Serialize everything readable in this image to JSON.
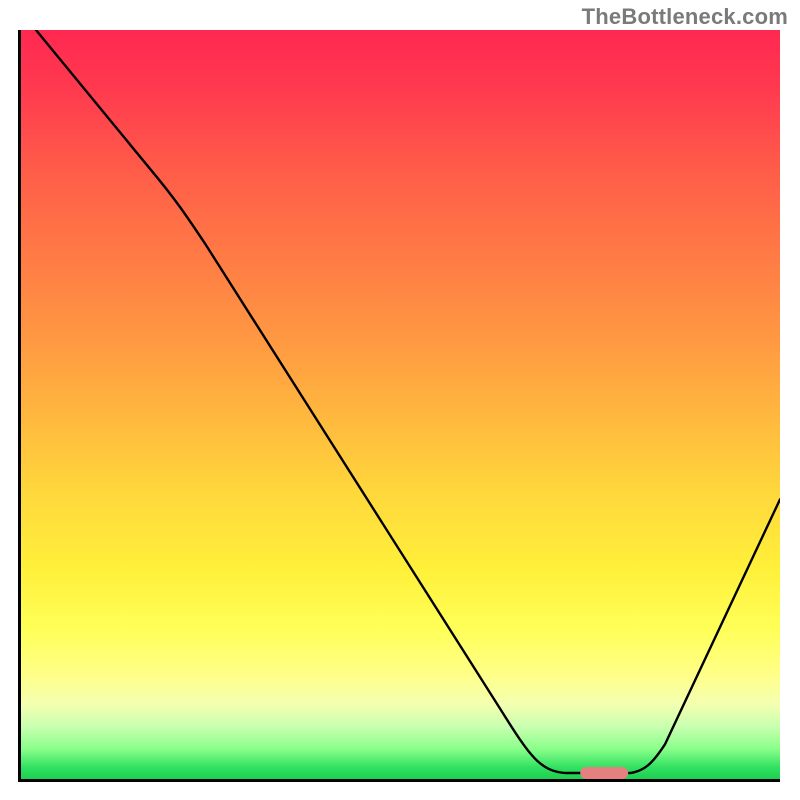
{
  "watermark": "TheBottleneck.com",
  "chart_data": {
    "type": "line",
    "title": "",
    "xlabel": "",
    "ylabel": "",
    "x_range": [
      0,
      100
    ],
    "y_range": [
      0,
      100
    ],
    "grid": false,
    "legend": false,
    "color_map": "vertical gradient red→orange→yellow→green representing bottleneck severity (red=high, green=low)",
    "series": [
      {
        "name": "bottleneck-curve",
        "x": [
          2,
          12,
          20,
          28,
          36,
          44,
          52,
          58,
          64,
          68,
          72,
          76,
          80,
          86,
          92,
          100
        ],
        "y": [
          100,
          88,
          77,
          67,
          55,
          44,
          33,
          22,
          11,
          4,
          1,
          0,
          1,
          8,
          20,
          38
        ]
      }
    ],
    "marker": {
      "name": "optimal-point",
      "x": 76,
      "y": 0,
      "shape": "rounded-rect",
      "color": "#e58080"
    },
    "annotations": []
  }
}
